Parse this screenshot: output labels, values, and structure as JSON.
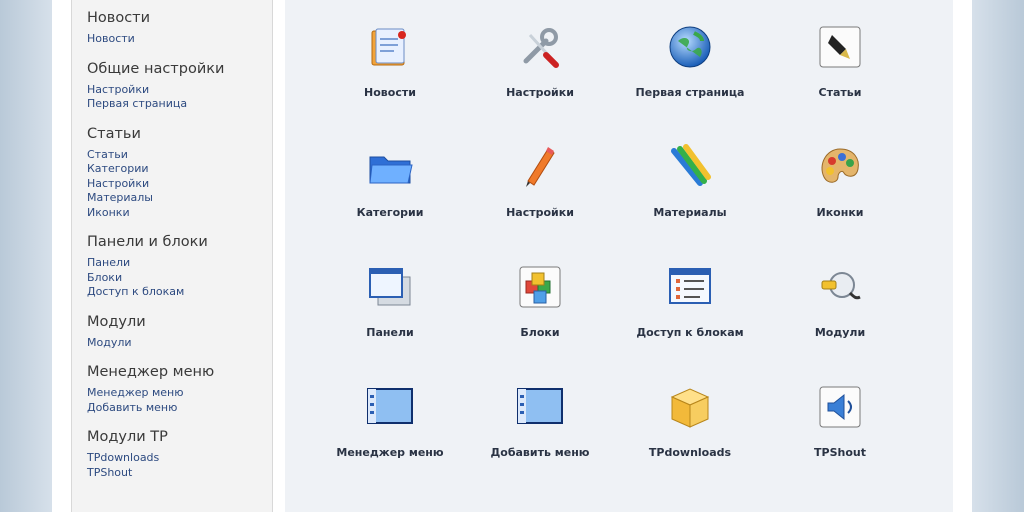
{
  "sidebar": {
    "sections": [
      {
        "title": "Новости",
        "links": [
          "Новости"
        ]
      },
      {
        "title": "Общие настройки",
        "links": [
          "Настройки",
          "Первая страница"
        ]
      },
      {
        "title": "Статьи",
        "links": [
          "Статьи",
          "Категории",
          "Настройки",
          "Материалы",
          "Иконки"
        ]
      },
      {
        "title": "Панели и блоки",
        "links": [
          "Панели",
          "Блоки",
          "Доступ к блокам"
        ]
      },
      {
        "title": "Модули",
        "links": [
          "Модули"
        ]
      },
      {
        "title": "Менеджер меню",
        "links": [
          "Менеджер меню",
          "Добавить меню"
        ]
      },
      {
        "title": "Модули TP",
        "links": [
          "TPdownloads",
          "TPShout"
        ]
      }
    ]
  },
  "main": {
    "tiles": [
      {
        "label": "Новости",
        "icon": "news-icon"
      },
      {
        "label": "Настройки",
        "icon": "tools-icon"
      },
      {
        "label": "Первая страница",
        "icon": "globe-icon"
      },
      {
        "label": "Статьи",
        "icon": "pen-nib-icon"
      },
      {
        "label": "Категории",
        "icon": "folder-icon"
      },
      {
        "label": "Настройки",
        "icon": "pencil-icon"
      },
      {
        "label": "Материалы",
        "icon": "crayons-icon"
      },
      {
        "label": "Иконки",
        "icon": "palette-icon"
      },
      {
        "label": "Панели",
        "icon": "windows-icon"
      },
      {
        "label": "Блоки",
        "icon": "blocks-icon"
      },
      {
        "label": "Доступ к блокам",
        "icon": "access-list-icon"
      },
      {
        "label": "Модули",
        "icon": "plugin-icon"
      },
      {
        "label": "Менеджер меню",
        "icon": "menu-window-icon"
      },
      {
        "label": "Добавить меню",
        "icon": "add-menu-window-icon"
      },
      {
        "label": "TPdownloads",
        "icon": "box-icon"
      },
      {
        "label": "TPShout",
        "icon": "speaker-icon"
      }
    ]
  }
}
